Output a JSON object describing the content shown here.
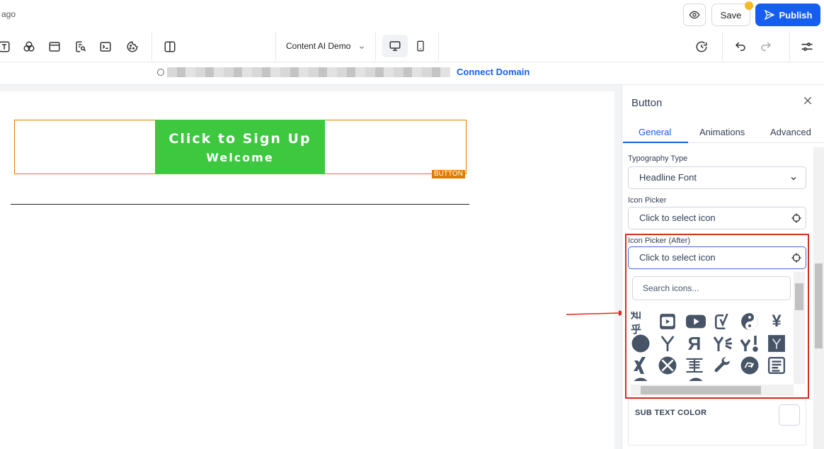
{
  "topbar": {
    "time_ago": "ago",
    "save_label": "Save",
    "publish_label": "Publish",
    "accent_color": "#155eef"
  },
  "toolbar": {
    "page_select_value": "Content AI Demo"
  },
  "domainbar": {
    "connect_domain_label": "Connect Domain"
  },
  "canvas": {
    "button_text": "Click to Sign Up",
    "button_subtext": "Welcome",
    "element_tag": "BUTTON",
    "button_color": "#3dc83f",
    "selection_color": "#e07b00"
  },
  "panel": {
    "title": "Button",
    "tabs": [
      {
        "label": "General",
        "active": true
      },
      {
        "label": "Animations",
        "active": false
      },
      {
        "label": "Advanced",
        "active": false
      }
    ],
    "typography_label": "Typography Type",
    "typography_value": "Headline Font",
    "icon_picker_label": "Icon Picker",
    "icon_picker_placeholder": "Click to select icon",
    "icon_picker_after_label": "Icon Picker (After)",
    "icon_picker_after_placeholder": "Click to select icon",
    "search_icons_placeholder": "Search icons...",
    "icons": [
      "zhihu-icon",
      "youtube-square-icon",
      "youtube-icon",
      "yoast-icon",
      "yin-yang-icon",
      "yen-icon",
      "circle-icon",
      "y-combinator-icon",
      "yandex-icon",
      "yandex-international-icon",
      "yahoo-icon",
      "y-combinator-square-icon",
      "xing-icon",
      "xbox-icon",
      "xhosa-icon",
      "wrench-icon",
      "wpressr-icon",
      "wpforms-icon"
    ],
    "zhihu_text": "知乎",
    "yandex_text": "Я",
    "yen_text": "¥",
    "sub_text_color_label": "SUB TEXT COLOR"
  }
}
